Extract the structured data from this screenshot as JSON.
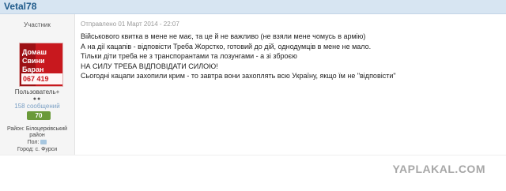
{
  "post": {
    "username": "Vetal78",
    "date": "Отправлено 01 Март 2014 - 22:07",
    "lines": [
      "Військового квитка в мене не має, та це й не важливо (не взяли мене чомусь в армію)",
      "А на дії кацапів - відповісти Треба Жорстко, готовий до дій, однодумців в мене не мало.",
      "Тільки діти треба не з транспорантами та лозунгами - а зі зброєю",
      "НА СИЛУ ТРЕБА ВІДПОВІДАТИ СИЛОЮ!",
      "Сьогодні кацапи захопили крим - то завтра вони захоплять всю Україну, якщо їм не \"відповісти\""
    ]
  },
  "author": {
    "rank_title": "Участник",
    "avatar_lines": [
      "Домаш",
      "Свини",
      "Баран"
    ],
    "avatar_phone": "067 419",
    "group": "Пользователь+",
    "dots": "●●",
    "messages": "158 сообщений",
    "reputation": "70",
    "district_label": "Район: Білоцерківський",
    "district_cont": "район",
    "gender_label": "Пол:",
    "city": "Город: с. Фурси"
  },
  "watermark": "YAPLAKAL.COM",
  "colors": {
    "header_bg": "#d7e5f2",
    "username": "#1f5a8a",
    "reputation_bg": "#6a9a3a",
    "avatar_bg": "#c8181e"
  },
  "icons": {
    "gender": "gender-icon"
  }
}
